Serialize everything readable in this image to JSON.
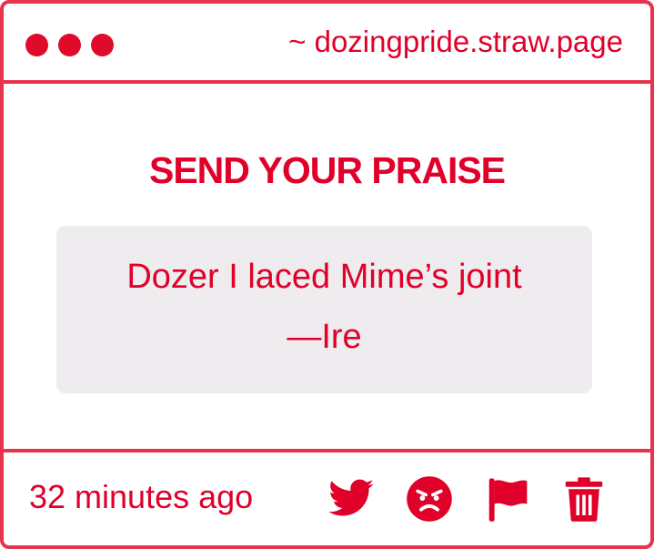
{
  "window": {
    "url": "~ dozingpride.straw.page",
    "controls": [
      "close-dot",
      "minimize-dot",
      "maximize-dot"
    ]
  },
  "main": {
    "heading": "SEND YOUR PRAISE",
    "message_lines": [
      "Dozer I laced Mime’s joint",
      "—Ire"
    ]
  },
  "footer": {
    "timestamp": "32 minutes ago",
    "actions": [
      "twitter-icon",
      "angry-face-icon",
      "flag-icon",
      "trash-icon"
    ]
  },
  "colors": {
    "accent": "#e0002a",
    "border": "#e8334d",
    "message_bg": "#eeecee",
    "background": "#ffffff"
  }
}
